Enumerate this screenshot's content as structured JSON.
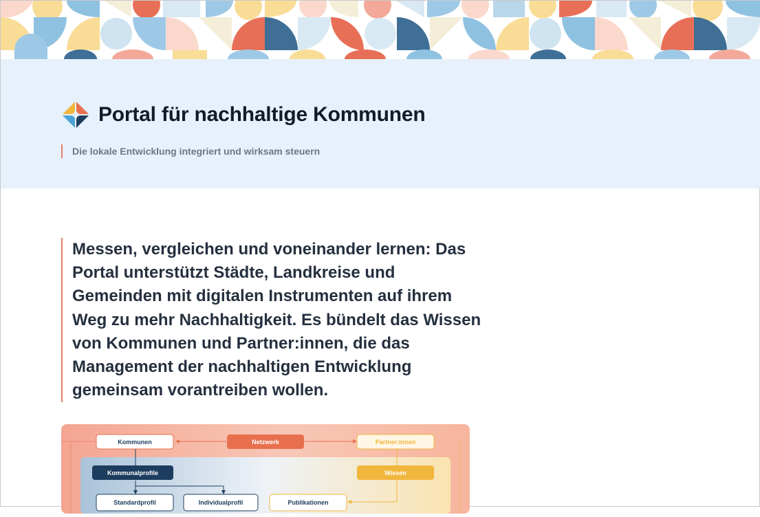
{
  "header": {
    "title": "Portal für nachhaltige Kommunen",
    "subtitle": "Die lokale Entwicklung integriert und wirksam steuern",
    "logo_icon": "colorful-quadrant-logo-icon",
    "banner": "geometric-pattern-banner"
  },
  "intro": {
    "text": "Messen, vergleichen und voneinander lernen: Das Portal unterstützt Städte, Landkreise und Gemeinden mit digitalen Instrumenten auf ihrem Weg zu mehr Nachhaltigkeit. Es bündelt das Wissen von Kommunen und Partner:innen, die das Management der nachhaltigen Entwicklung gemeinsam vorantreiben wollen."
  },
  "diagram": {
    "kommunen": "Kommunen",
    "netzwerk": "Netzwerk",
    "partner": "Partner:innen",
    "kommunalprofile": "Kommunalprofile",
    "wissen": "Wissen",
    "standardprofil": "Standardprofil",
    "individualprofil": "Individualprofil",
    "publikationen": "Publikationen"
  },
  "colors": {
    "accent": "#e0826b",
    "hero_bg": "#e6f1fb",
    "navy": "#1d3d5e",
    "orange": "#e8704f",
    "yellow": "#f1b73d"
  }
}
